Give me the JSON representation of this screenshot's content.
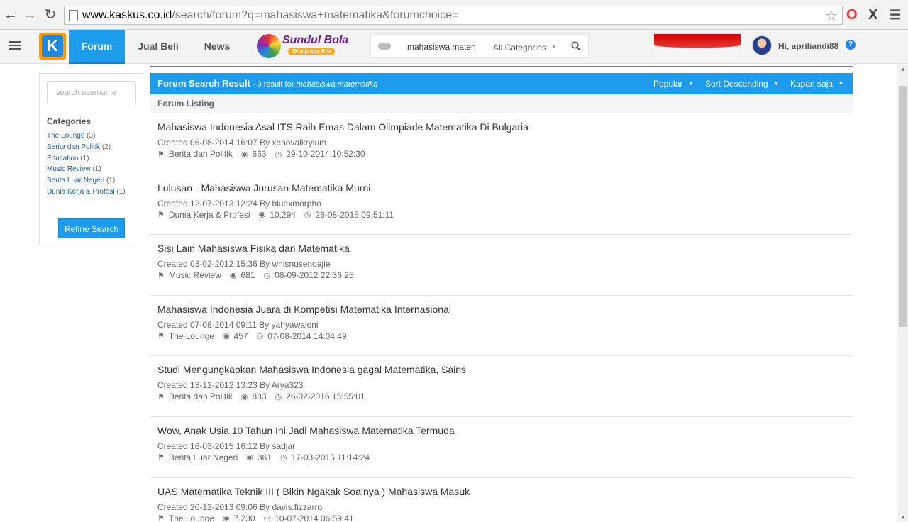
{
  "browser": {
    "url_host": "www.kaskus.co.id",
    "url_path": "/search/forum?q=mahasiswa+matematika&forumchoice="
  },
  "header": {
    "logo_letter": "K",
    "tabs": [
      {
        "label": "Forum",
        "active": true
      },
      {
        "label": "Jual Beli",
        "active": false
      },
      {
        "label": "News",
        "active": false
      }
    ],
    "promo_title": "Sundul Bola",
    "promo_sub": "Olimpiade Rio",
    "search_value": "mahasiswa maten",
    "category_select": "All Categories",
    "greeting": "Hi, apriliandi88",
    "help_label": "?"
  },
  "sidebar": {
    "username_placeholder": "search username",
    "categories_title": "Categories",
    "categories": [
      {
        "name": "The Lounge",
        "count": "(3)"
      },
      {
        "name": "Berita dan Politik",
        "count": "(2)"
      },
      {
        "name": "Education",
        "count": "(1)"
      },
      {
        "name": "Music Review",
        "count": "(1)"
      },
      {
        "name": "Berita Luar Negeri",
        "count": "(1)"
      },
      {
        "name": "Dunia Kerja & Profesi",
        "count": "(1)"
      }
    ],
    "refine_label": "Refine Search"
  },
  "results_header": {
    "title": "Forum Search Result",
    "sub_prefix": " - 9 result for ",
    "query": "mahasiswa matematika",
    "sort_popular": "Popular",
    "sort_order": "Sort Descending",
    "time_filter": "Kapan saja"
  },
  "listing_label": "Forum Listing",
  "results": [
    {
      "title": "Mahasiswa Indonesia Asal ITS Raih Emas Dalam Olimpiade Matematika Di Bulgaria",
      "meta": "Created 06-08-2014 16:07 By xenovalkryium",
      "category": "Berita dan Politik",
      "views": "663",
      "last": "29-10-2014 10:52:30"
    },
    {
      "title": "Lulusan - Mahasiswa Jurusan Matematika Murni",
      "meta": "Created 12-07-2013 12:24 By bluexmorpho",
      "category": "Dunia Kerja & Profesi",
      "views": "10,294",
      "last": "26-08-2015 09:51:11"
    },
    {
      "title": "Sisi Lain Mahasiswa Fisika dan Matematika",
      "meta": "Created 03-02-2012 15:36 By whisnusenoajie",
      "category": "Music Review",
      "views": "681",
      "last": "08-09-2012 22:36:25"
    },
    {
      "title": "Mahasiswa Indonesia Juara di Kompetisi Matematika Internasional",
      "meta": "Created 07-08-2014 09:11 By yahyawaloni",
      "category": "The Lounge",
      "views": "457",
      "last": "07-08-2014 14:04:49"
    },
    {
      "title": "Studi Mengungkapkan Mahasiswa Indonesia gagal Matematika, Sains",
      "meta": "Created 13-12-2012 13:23 By Arya323",
      "category": "Berita dan Politik",
      "views": "883",
      "last": "26-02-2016 15:55:01"
    },
    {
      "title": "Wow, Anak Usia 10 Tahun Ini Jadi Mahasiswa Matematika Termuda",
      "meta": "Created 16-03-2015 16:12 By sadjar",
      "category": "Berita Luar Negeri",
      "views": "361",
      "last": "17-03-2015 11:14:24"
    },
    {
      "title": "UAS Matematika Teknik III ( Bikin Ngakak Soalnya ) Mahasiswa Masuk",
      "meta": "Created 20-12-2013 09:06 By davis.fizzarro",
      "category": "The Lounge",
      "views": "7,230",
      "last": "10-07-2014 06:59:41"
    }
  ],
  "icons": {
    "back": "back-arrow-icon",
    "forward": "forward-arrow-icon",
    "reload": "reload-icon",
    "star": "bookmark-star-icon",
    "tag": "tag-icon",
    "eye": "eye-icon",
    "clock": "clock-icon",
    "search": "search-icon"
  },
  "colors": {
    "accent": "#1e9cec",
    "logo_orange": "#ff9900",
    "link": "#1e5fa8"
  }
}
